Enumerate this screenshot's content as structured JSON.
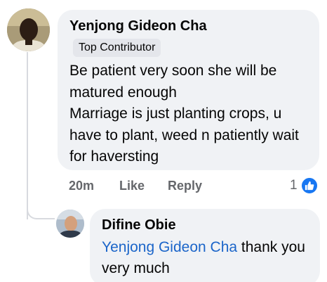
{
  "comment": {
    "author": "Yenjong Gideon Cha",
    "badge": "Top Contributor",
    "text": "Be patient very soon she will be matured enough\n Marriage is just planting crops, u have to plant, weed n patiently wait for haversting",
    "time": "20m",
    "like_label": "Like",
    "reply_label": "Reply",
    "reaction_count": "1",
    "reaction_icon": "thumbs-up-icon"
  },
  "reply": {
    "author": "Difine Obie",
    "mention": "Yenjong Gideon Cha",
    "text": " thank you very much"
  },
  "colors": {
    "bubble": "#f0f2f5",
    "link": "#1b65c9",
    "like_blue": "#1877f2",
    "meta": "#65676b"
  }
}
